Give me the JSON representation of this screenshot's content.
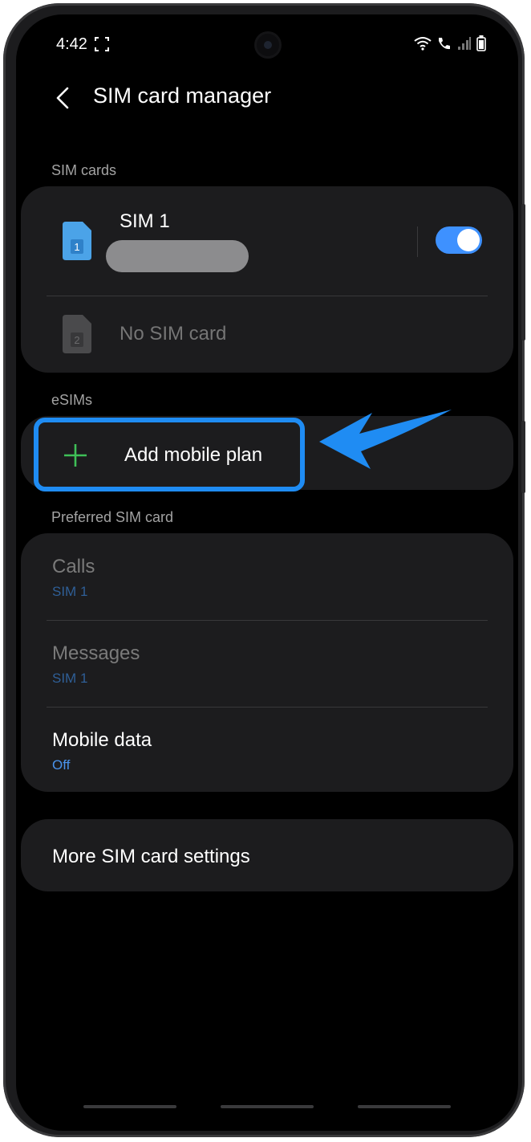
{
  "status_bar": {
    "time": "4:42"
  },
  "header": {
    "title": "SIM card manager"
  },
  "sections": {
    "sim_cards": "SIM cards",
    "esims": "eSIMs",
    "preferred": "Preferred SIM card"
  },
  "sim_cards": {
    "sim1": {
      "badge": "1",
      "name": "SIM 1",
      "enabled": true
    },
    "sim2": {
      "badge": "2",
      "label": "No SIM card"
    }
  },
  "esims": {
    "add_label": "Add mobile plan"
  },
  "preferred": {
    "calls": {
      "title": "Calls",
      "value": "SIM 1"
    },
    "messages": {
      "title": "Messages",
      "value": "SIM 1"
    },
    "mobile_data": {
      "title": "Mobile data",
      "value": "Off"
    }
  },
  "more_settings": "More SIM card settings",
  "colors": {
    "accent": "#3e91ff",
    "highlight": "#1f8cf3",
    "card": "#1c1c1e",
    "add_plus": "#3fbf57"
  }
}
